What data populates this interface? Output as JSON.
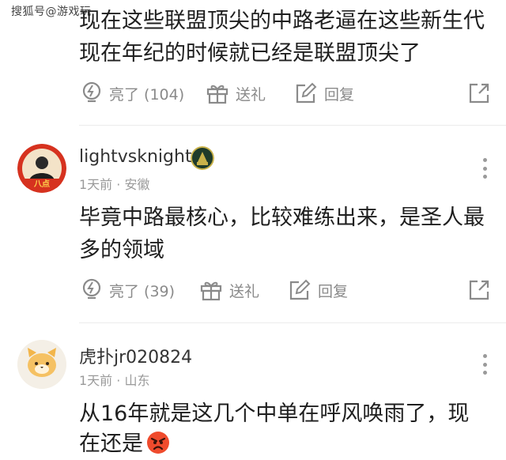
{
  "watermark": "搜狐号@游戏玩",
  "top_comment": {
    "body_line1": "现在这些联盟顶尖的中路老逼在这些新生代",
    "body_line2": "现在年纪的时候就已经是联盟顶尖了",
    "actions": {
      "like_label": "亮了 (104)",
      "gift_label": "送礼",
      "reply_label": "回复"
    }
  },
  "comments": [
    {
      "username": "lightvsknight",
      "time": "1天前",
      "separator": "·",
      "location": "安徽",
      "avatar_text": "八点",
      "body_line1": "毕竟中路最核心，比较难练出来，是圣人最",
      "body_line2": "多的领域",
      "actions": {
        "like_label": "亮了 (39)",
        "gift_label": "送礼",
        "reply_label": "回复"
      }
    },
    {
      "username": "虎扑jr020824",
      "time": "1天前",
      "separator": "·",
      "location": "山东",
      "body_line1": "从16年就是这几个中单在呼风唤雨了，现",
      "body_line2": "在还是"
    }
  ],
  "colors": {
    "text": "#1f1f1f",
    "muted": "#8a8a8a",
    "meta": "#9a9a9a",
    "divider": "#ececec"
  },
  "icons": [
    "lightbulb-icon",
    "gift-icon",
    "edit-icon",
    "share-icon",
    "more-icon",
    "angry-emoji-icon"
  ]
}
